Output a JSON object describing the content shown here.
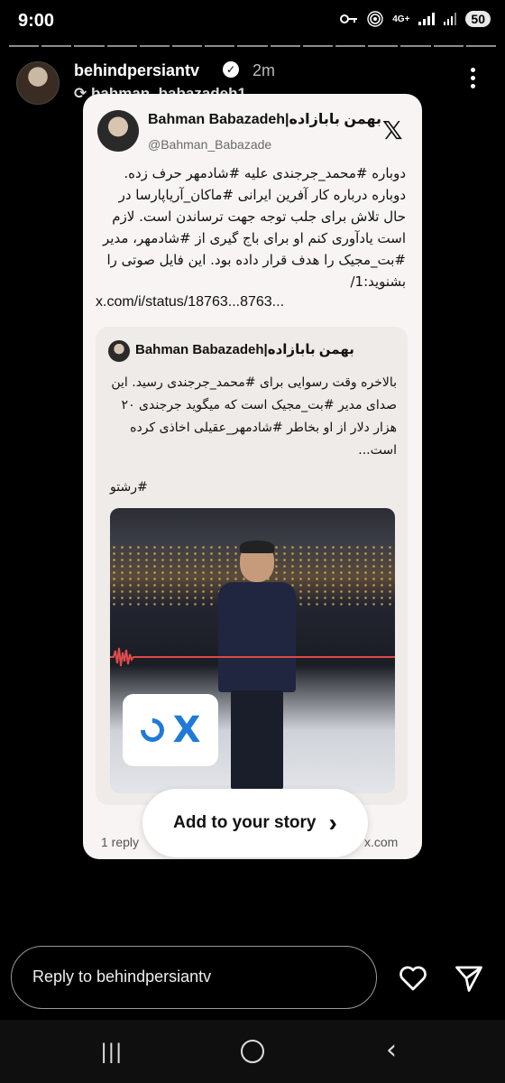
{
  "status_bar": {
    "time": "9:00",
    "network": "4G+",
    "battery": "50"
  },
  "story": {
    "segments": 15,
    "username": "behindpersiantv",
    "time_ago": "2m",
    "repost_from": "bahman_babazadeh1"
  },
  "tweet": {
    "name": "Bahman Babazadeh|بهمن بابازاده",
    "handle": "@Bahman_Babazade",
    "text": "دوباره #محمد_جرجندی علیه #شادمهر حرف زده. دوباره درباره کار آفرین ایرانی #ماکان_آریاپارسا در حال تلاش برای جلب توجه جهت ترساندن است. لازم است یادآوری کنم او برای باج گیری از #شادمهر، مدیر #بت_مجیک را هدف قرار داده بود. این فایل صوتی را بشنوید:1/",
    "link": "x.com/i/status/18763...8763..."
  },
  "quoted_tweet": {
    "name": "Bahman Babazadeh|بهمن بابازاده",
    "text": "بالاخره وقت رسوایی برای #محمد_جرجندی رسید. این صدای مدیر #بت_مجیک است که میگوید جرجندی ۲۰ هزار دلار از او بخاطر #شادمهر_عقیلی اخاذی کرده است...",
    "hashtag": "#رشتو",
    "footer_left": "1 reply",
    "footer_right": "x.com"
  },
  "add_to_story": {
    "label": "Add to your story",
    "chevron": "›"
  },
  "reply": {
    "placeholder": "Reply to behindpersiantv"
  },
  "icons": {
    "verified": "✓",
    "x_logo": "𝕏",
    "badge_x": "X"
  },
  "colors": {
    "link_blue": "#1f7ad6",
    "card_bg": "#f7f4f3"
  }
}
